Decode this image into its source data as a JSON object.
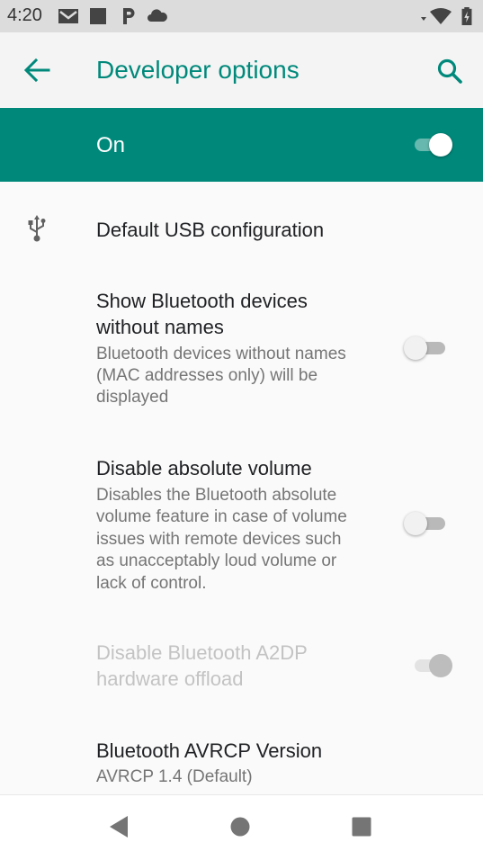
{
  "status_bar": {
    "time": "4:20",
    "icons": [
      "gmail-icon",
      "square-icon",
      "p-icon",
      "cloud-icon",
      "wifi-icon",
      "battery-icon"
    ]
  },
  "app_bar": {
    "title": "Developer options",
    "back_icon": "arrow-left-icon",
    "search_icon": "search-icon"
  },
  "master_switch": {
    "label": "On",
    "checked": true
  },
  "settings": [
    {
      "icon": "usb-icon",
      "title": "Default USB configuration"
    },
    {
      "title_lines": [
        "Show Bluetooth devices",
        "without names"
      ],
      "summary_lines": [
        "Bluetooth devices without names",
        "(MAC addresses only) will be",
        "displayed"
      ],
      "checked": false
    },
    {
      "title": "Disable absolute volume",
      "summary_lines": [
        "Disables the Bluetooth absolute",
        "volume feature in case of volume",
        "issues with remote devices such",
        "as unacceptably loud volume or",
        "lack of control."
      ],
      "checked": false
    },
    {
      "title_lines": [
        "Disable Bluetooth A2DP",
        "hardware offload"
      ],
      "disabled": true,
      "checked": true
    },
    {
      "title": "Bluetooth AVRCP Version",
      "summary": "AVRCP 1.4 (Default)"
    }
  ],
  "nav_bar": {
    "buttons": [
      "back-triangle-icon",
      "home-circle-icon",
      "recents-square-icon"
    ]
  },
  "colors": {
    "accent": "#00897b",
    "status_bar": "#dcdcdc",
    "app_bar": "#f4f4f4",
    "background": "#fafafa"
  }
}
